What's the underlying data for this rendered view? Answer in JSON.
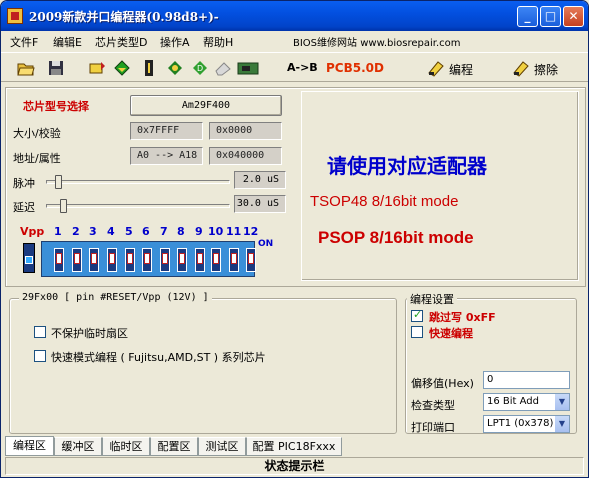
{
  "window": {
    "title": "2009新款并口编程器(0.98d8+)-"
  },
  "titlebar_buttons": {
    "minimize": "_",
    "maximize": "□",
    "close": "✕"
  },
  "menu": {
    "file": "文件F",
    "edit": "编辑E",
    "chip_type": "芯片类型D",
    "operate": "操作A",
    "help": "帮助H",
    "bios_site": "BIOS维修网站 www.biosrepair.com"
  },
  "toolbar": {
    "icons": [
      "open-folder-icon",
      "save-disk-icon",
      "read-chip-icon",
      "verify-chip-icon",
      "blank-check-icon",
      "chip-info-icon",
      "compare-icon",
      "erase-small-icon",
      "board-icon"
    ],
    "a_to_b": "A->B",
    "pcb": "PCB5.0D",
    "program_label": "编程",
    "erase_label": "擦除",
    "pcb_color": "#e03000"
  },
  "chip": {
    "select_label": "芯片型号选择",
    "name": "Am29F400",
    "size_label": "大小/校验",
    "size": "0x7FFFF",
    "checksum": "0x0000",
    "addr_label": "地址/属性",
    "addr": "A0 --> A18",
    "attr": "0x040000",
    "pulse_label": "脉冲",
    "pulse_value": "2.0 uS",
    "pulse_level": 0.05,
    "delay_label": "延迟",
    "delay_value": "30.0 uS",
    "delay_level": 0.08,
    "vpp_label": "Vpp",
    "pins": [
      "1",
      "2",
      "3",
      "4",
      "5",
      "6",
      "7",
      "8",
      "9",
      "10",
      "11",
      "12"
    ],
    "on_label": "ON"
  },
  "adapter": {
    "title": "请使用对应适配器",
    "line1": "TSOP48 8/16bit mode",
    "line2": "PSOP 8/16bit mode",
    "title_color": "#0000cc",
    "line_color": "#cc0000"
  },
  "options": {
    "group_title": "29Fx00 [ pin #RESET/Vpp (12V) ]",
    "unprotect": "不保护临时扇区",
    "fast_mode": "快速模式编程 ( Fujitsu,AMD,ST ) 系列芯片"
  },
  "prog_settings": {
    "title": "编程设置",
    "skip_ff": "跳过写 0xFF",
    "fast_program": "快速编程",
    "offset_label": "偏移值(Hex)",
    "offset": "0",
    "check_label": "检查类型",
    "check_type": "16 Bit Add",
    "port_label": "打印端口",
    "port": "LPT1 (0x378)"
  },
  "tabs": [
    "编程区",
    "缓冲区",
    "临时区",
    "配置区",
    "测试区",
    "配置 PIC18Fxxx"
  ],
  "status": "状态提示栏"
}
